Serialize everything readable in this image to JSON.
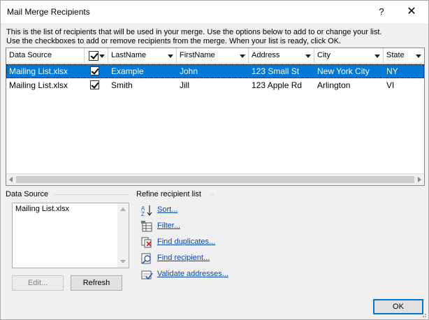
{
  "window": {
    "title": "Mail Merge Recipients",
    "help": "?",
    "close": "✕"
  },
  "description": "This is the list of recipients that will be used in your merge.  Use the options below to add to or change your list.\nUse the checkboxes to add or remove recipients from the merge.  When your list is ready, click OK.",
  "table": {
    "columns": [
      "Data Source",
      "",
      "LastName",
      "FirstName",
      "Address",
      "City",
      "State"
    ],
    "rows": [
      {
        "source": "Mailing List.xlsx",
        "checked": true,
        "last": "Example",
        "first": "John",
        "address": "123 Small St",
        "city": "New York City",
        "state": "NY"
      },
      {
        "source": "Mailing List.xlsx",
        "checked": true,
        "last": "Smith",
        "first": "Jill",
        "address": "123 Apple Rd",
        "city": "Arlington",
        "state": "VI"
      }
    ]
  },
  "data_source_group": {
    "label": "Data Source",
    "items": [
      "Mailing List.xlsx"
    ],
    "edit_label": "Edit...",
    "refresh_label": "Refresh"
  },
  "refine_group": {
    "label": "Refine recipient list",
    "links": [
      {
        "label": "Sort...",
        "icon": "sort-icon"
      },
      {
        "label": "Filter...",
        "icon": "filter-icon"
      },
      {
        "label": "Find duplicates...",
        "icon": "find-duplicates-icon"
      },
      {
        "label": "Find recipient...",
        "icon": "find-recipient-icon"
      },
      {
        "label": "Validate addresses...",
        "icon": "validate-addresses-icon"
      }
    ]
  },
  "ok_label": "OK",
  "colors": {
    "selection": "#0078d7",
    "link": "#0645ad",
    "accent": "#0078d7"
  }
}
